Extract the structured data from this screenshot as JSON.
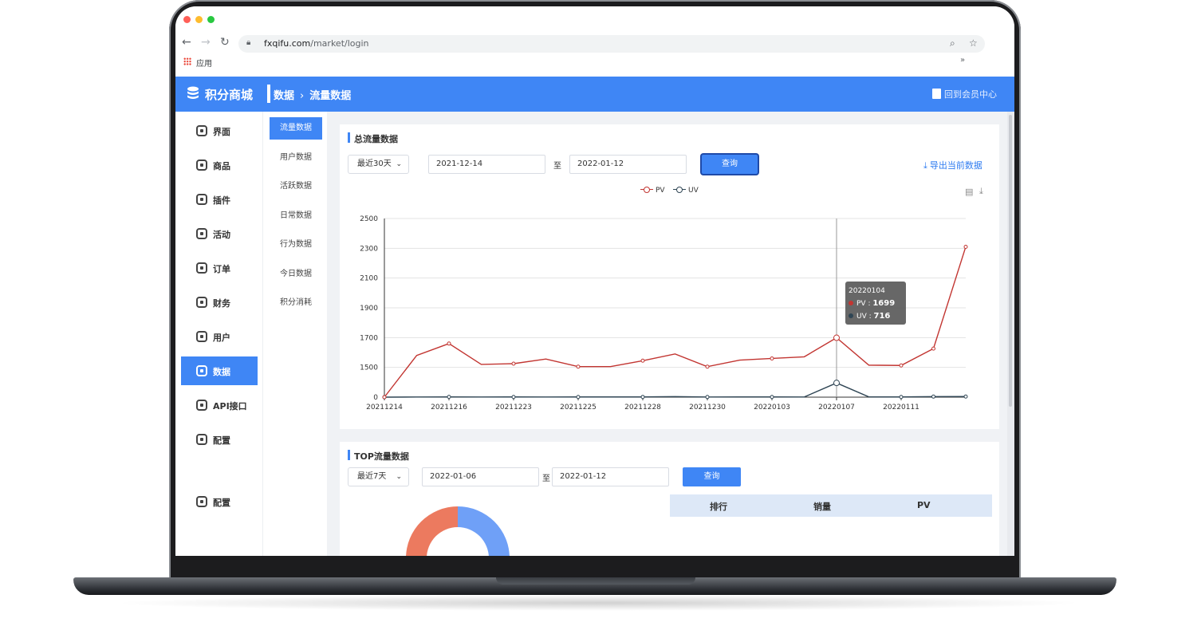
{
  "browser": {
    "url_host": "fxqifu.com",
    "url_path": "/market/login",
    "bookmark_apps": "应用",
    "bookmarks_more": "»"
  },
  "header": {
    "app_title": "积分商城",
    "breadcrumb_root": "数据",
    "breadcrumb_sep": "›",
    "breadcrumb_current": "流量数据",
    "back_link": "回到会员中心"
  },
  "sidebar": {
    "items": [
      {
        "label": "界面",
        "icon": "shirt-icon"
      },
      {
        "label": "商品",
        "icon": "box-icon"
      },
      {
        "label": "插件",
        "icon": "plugin-icon"
      },
      {
        "label": "活动",
        "icon": "gift-icon"
      },
      {
        "label": "订单",
        "icon": "order-icon"
      },
      {
        "label": "财务",
        "icon": "finance-icon"
      },
      {
        "label": "用户",
        "icon": "user-icon"
      },
      {
        "label": "数据",
        "icon": "chart-icon",
        "active": true
      },
      {
        "label": "API接口",
        "icon": "api-icon"
      },
      {
        "label": "配置",
        "icon": "gear-icon"
      },
      {
        "label": "配置",
        "icon": "gear-icon"
      }
    ]
  },
  "subnav": {
    "items": [
      {
        "label": "流量数据",
        "active": true
      },
      {
        "label": "用户数据"
      },
      {
        "label": "活跃数据"
      },
      {
        "label": "日常数据"
      },
      {
        "label": "行为数据"
      },
      {
        "label": "今日数据"
      },
      {
        "label": "积分消耗"
      }
    ]
  },
  "total": {
    "title": "总流量数据",
    "range_select": "最近30天",
    "start_date": "2021-12-14",
    "to_label": "至",
    "end_date": "2022-01-12",
    "query_label": "查询",
    "export_label": "导出当前数据"
  },
  "tooltip": {
    "date": "20220104",
    "pv_label": "PV : ",
    "pv_value": "1699",
    "uv_label": "UV : ",
    "uv_value": "716"
  },
  "chart_data": {
    "type": "line",
    "title": "",
    "xlabel": "",
    "ylabel": "",
    "ylim": [
      0,
      2500
    ],
    "y_ticks": [
      "0",
      "1500",
      "1700",
      "1900",
      "2100",
      "2300",
      "2500"
    ],
    "x_ticks": [
      "20211214",
      "20211216",
      "20211223",
      "20211225",
      "20211228",
      "20211230",
      "20220103",
      "20220107",
      "20220111"
    ],
    "grid": true,
    "legend": "top-center",
    "series": [
      {
        "name": "PV",
        "color": "#c23531",
        "values": [
          0,
          1580,
          1660,
          1520,
          1525,
          1556,
          1505,
          1505,
          1545,
          1590,
          1505,
          1549,
          1560,
          1571,
          1699,
          1515,
          1513,
          1626,
          2310
        ]
      },
      {
        "name": "UV",
        "color": "#2f4554",
        "values": [
          0,
          8,
          14,
          9,
          10,
          9,
          10,
          10,
          12,
          28,
          8,
          12,
          11,
          9,
          716,
          12,
          10,
          28,
          30
        ]
      }
    ]
  },
  "top": {
    "title": "TOP流量数据",
    "range_select": "最近7天",
    "start_date": "2022-01-06",
    "to_label": "至",
    "end_date": "2022-01-12",
    "query_label": "查询",
    "col_rank": "排行",
    "col_sales": "销量",
    "col_pv": "PV",
    "donut_colors": [
      "#6fa0f7",
      "#ec7a5f"
    ]
  }
}
